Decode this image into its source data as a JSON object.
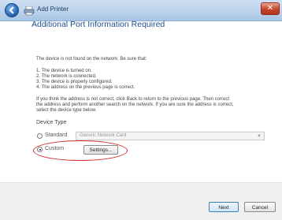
{
  "titlebar": {
    "title": "Add Printer",
    "close_symbol": "✕"
  },
  "page": {
    "heading": "Additional Port Information Required",
    "intro": "The device is not found on the network.  Be sure that:",
    "checklist": [
      "1.  The device is turned on.",
      "2.  The network is connected.",
      "3.  The device is properly configured.",
      "4.  The address on the previous page is correct."
    ],
    "instruction_lines": [
      "If you think the address is not correct, click Back to return to the previous page.  Then correct",
      "the address and perform another search on the network.  If you are sure the address is correct,",
      "select the device type below."
    ]
  },
  "device_type": {
    "label": "Device Type",
    "standard_label": "Standard",
    "standard_selected": false,
    "standard_value": "Generic Network Card",
    "custom_label": "Custom",
    "custom_selected": true,
    "settings_label": "Settings..."
  },
  "footer": {
    "next_label": "Next",
    "cancel_label": "Cancel"
  },
  "annotation": {
    "highlight_color": "#d22b2b"
  }
}
